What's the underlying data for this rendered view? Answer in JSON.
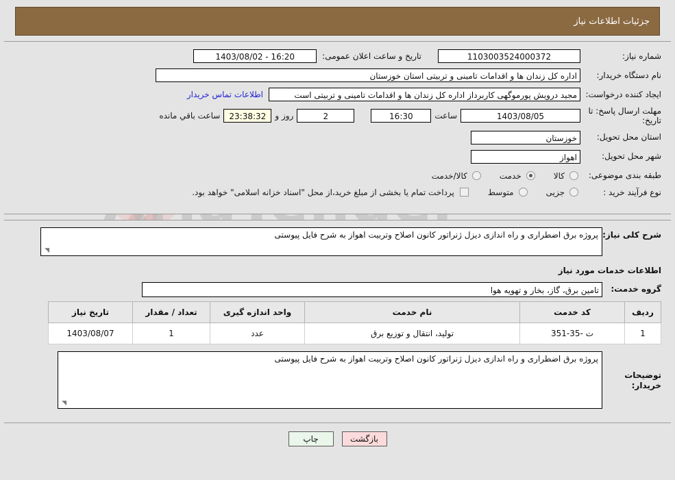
{
  "header": {
    "title": "جزئیات اطلاعات نیاز"
  },
  "colors": {
    "header_bar": "#8b6a42",
    "page_bg": "#e4e4e4",
    "link": "#2424d6",
    "countdown_bg": "#ffffe4",
    "print_btn_bg": "#e9f6e9",
    "back_btn_bg": "#fadada"
  },
  "watermark": {
    "text": "AriaTender.net",
    "brand": "AriaTender",
    "suffix": ".net"
  },
  "summary": {
    "need_number_label": "شماره نیاز:",
    "need_number_value": "1103003524000372",
    "announce_label": "تاریخ و ساعت اعلان عمومی:",
    "announce_value": "1403/08/02 - 16:20",
    "buyer_org_label": "نام دستگاه خریدار:",
    "buyer_org_value": "اداره کل زندان ها و اقدامات تامینی و تربیتی استان خوزستان",
    "creator_label": "ایجاد کننده درخواست:",
    "creator_value": "مجید درویش پورموگهی کاربرداز اداره کل زندان ها و اقدامات تامینی و تربیتی است",
    "buyer_contact_link": "اطلاعات تماس خریدار",
    "deadline_label": "مهلت ارسال پاسخ: تا تاریخ:",
    "deadline_date": "1403/08/05",
    "deadline_hour_label": "ساعت",
    "deadline_hour": "16:30",
    "days_remaining": "2",
    "days_word": "روز و",
    "countdown": "23:38:32",
    "countdown_suffix": "ساعت باقي مانده",
    "province_label": "استان محل تحویل:",
    "province_value": "خوزستان",
    "city_label": "شهر محل تحویل:",
    "city_value": "اهواز",
    "category_label": "طبقه بندی موضوعی:",
    "category_options": [
      {
        "label": "کالا",
        "selected": false
      },
      {
        "label": "خدمت",
        "selected": true
      },
      {
        "label": "کالا/خدمت",
        "selected": false
      }
    ],
    "process_label": "نوع فرآیند خرید :",
    "process_options": [
      {
        "label": "جزیی",
        "selected": false
      },
      {
        "label": "متوسط",
        "selected": false
      }
    ],
    "treasury_checkbox_label": "پرداخت تمام یا بخشی از مبلغ خرید،از محل \"اسناد خزانه اسلامی\" خواهد بود.",
    "treasury_checked": false
  },
  "description": {
    "general_label": "شرح کلی نیاز:",
    "general_value": "پروژه برق اضطراری و راه اندازی دیزل ژنراتور کانون اصلاح وتربیت اهواز به شرح فایل پیوستی",
    "services_section_title": "اطلاعات خدمات مورد نیاز",
    "service_group_label": "گروه خدمت:",
    "service_group_value": "تامین برق، گاز، بخار و تهویه هوا"
  },
  "table": {
    "columns": [
      "ردیف",
      "کد خدمت",
      "نام خدمت",
      "واحد اندازه گیری",
      "تعداد / مقدار",
      "تاریخ نیاز"
    ],
    "rows": [
      {
        "row_no": "1",
        "service_code": "ت -35-351",
        "service_name": "تولید، انتقال و توزیع برق",
        "unit": "عدد",
        "quantity": "1",
        "need_date": "1403/08/07"
      }
    ]
  },
  "buyer_notes": {
    "label": "توضیحات خریدار:",
    "value": "پروژه برق اضطراری و راه اندازی دیزل ژنراتور کانون اصلاح وتربیت اهواز به شرح فایل پیوستی"
  },
  "footer": {
    "print_label": "چاپ",
    "back_label": "بازگشت"
  }
}
